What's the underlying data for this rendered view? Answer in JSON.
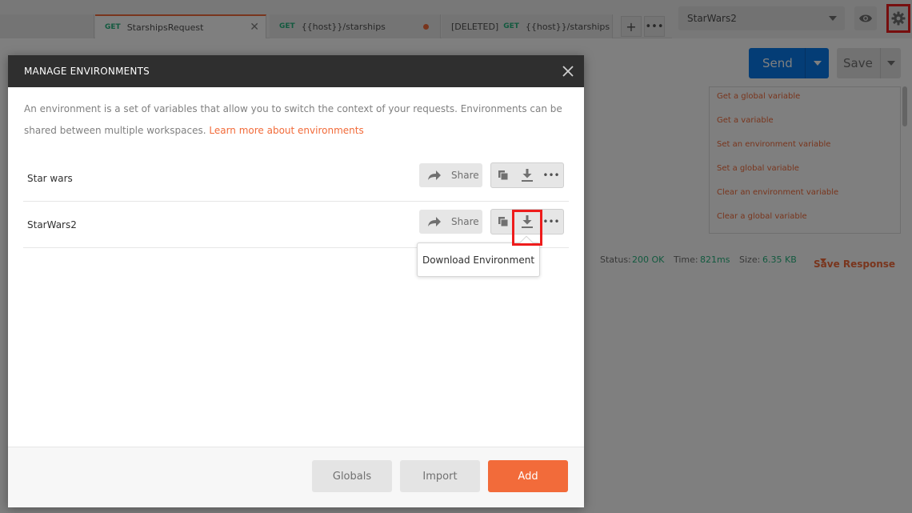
{
  "tabs": [
    {
      "method": "GET",
      "label": "StarshipsRequest",
      "active": true
    },
    {
      "method": "GET",
      "label": "{{host}}/starships",
      "unsaved": true
    },
    {
      "prefix": "[DELETED]",
      "method": "GET",
      "label": "{{host}}/starships"
    }
  ],
  "tabbar": {
    "new_tab_icon": "plus-icon",
    "more_icon": "ellipsis-icon"
  },
  "environment_selector": {
    "value": "StarWars2"
  },
  "request_bar": {
    "send_label": "Send",
    "save_label": "Save"
  },
  "snippets": [
    "Get a global variable",
    "Get a variable",
    "Set an environment variable",
    "Set a global variable",
    "Clear an environment variable",
    "Clear a global variable"
  ],
  "response": {
    "status_label": "Status:",
    "status_value": "200 OK",
    "time_label": "Time:",
    "time_value": "821ms",
    "size_label": "Size:",
    "size_value": "6.35 KB",
    "save_response_label": "Save Response"
  },
  "modal": {
    "title": "MANAGE ENVIRONMENTS",
    "description": "An environment is a set of variables that allow you to switch the context of your requests. Environments can be shared between multiple workspaces.",
    "learn_more": "Learn more about environments",
    "environments": [
      {
        "name": "Star wars",
        "share_label": "Share"
      },
      {
        "name": "StarWars2",
        "share_label": "Share"
      }
    ],
    "tooltip": "Download Environment",
    "footer": {
      "globals_label": "Globals",
      "import_label": "Import",
      "add_label": "Add"
    }
  },
  "colors": {
    "accent": "#f26b3a",
    "send": "#097bed",
    "success": "#26b47f",
    "highlight": "#ee1c1c",
    "modal_header": "#2f2f2f"
  }
}
